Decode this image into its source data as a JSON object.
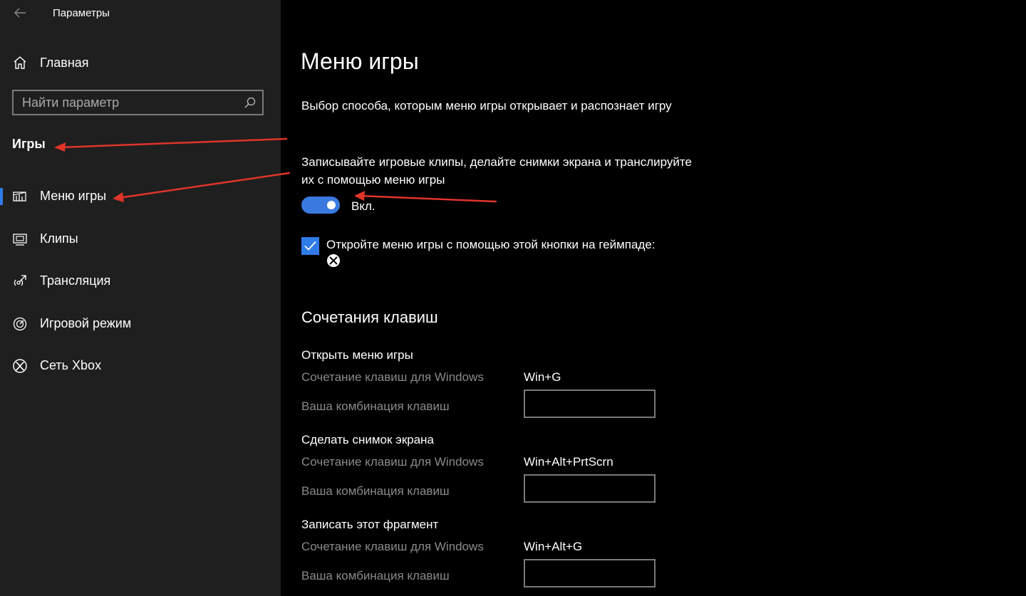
{
  "window": {
    "title": "Параметры"
  },
  "sidebar": {
    "home_label": "Главная",
    "search_placeholder": "Найти параметр",
    "section_title": "Игры",
    "items": [
      {
        "label": "Меню игры",
        "icon": "game-bar-icon",
        "selected": true
      },
      {
        "label": "Клипы",
        "icon": "captures-icon",
        "selected": false
      },
      {
        "label": "Трансляция",
        "icon": "broadcasting-icon",
        "selected": false
      },
      {
        "label": "Игровой режим",
        "icon": "game-mode-icon",
        "selected": false
      },
      {
        "label": "Сеть Xbox",
        "icon": "xbox-icon",
        "selected": false
      }
    ]
  },
  "main": {
    "title": "Меню игры",
    "description": "Выбор способа, которым меню игры открывает и распознает игру",
    "record_text": "Записывайте игровые клипы, делайте снимки экрана и транслируйте их с помощью меню игры",
    "toggle": {
      "state": true,
      "label": "Вкл."
    },
    "checkbox": {
      "checked": true,
      "label": "Откройте меню игры с помощью этой кнопки на геймпаде:"
    },
    "shortcuts_title": "Сочетания клавиш",
    "shortcuts": [
      {
        "title": "Открыть меню игры",
        "windows_label": "Сочетание клавиш для Windows",
        "windows_value": "Win+G",
        "custom_label": "Ваша комбинация клавиш",
        "custom_value": ""
      },
      {
        "title": "Сделать снимок экрана",
        "windows_label": "Сочетание клавиш для Windows",
        "windows_value": "Win+Alt+PrtScrn",
        "custom_label": "Ваша комбинация клавиш",
        "custom_value": ""
      },
      {
        "title": "Записать этот фрагмент",
        "windows_label": "Сочетание клавиш для Windows",
        "windows_value": "Win+Alt+G",
        "custom_label": "Ваша комбинация клавиш",
        "custom_value": ""
      }
    ]
  },
  "colors": {
    "accent": "#2f7be8",
    "sidebar_bg": "#1f1f1f",
    "content_bg": "#000000",
    "annotation": "#e0342a"
  }
}
